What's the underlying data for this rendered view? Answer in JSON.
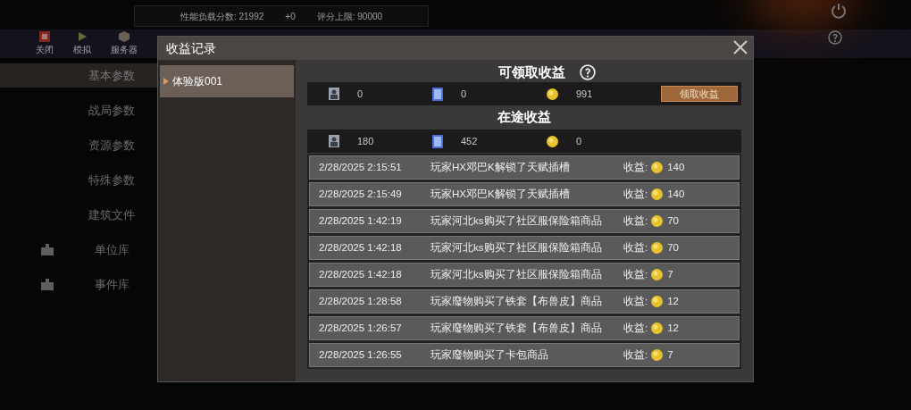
{
  "top_bar": {
    "score": "性能负载分数: 21992",
    "delta": "+0",
    "limit": "评分上限: 90000"
  },
  "toolbar": [
    {
      "label": "关闭",
      "kind": "stop"
    },
    {
      "label": "模拟",
      "kind": "play"
    },
    {
      "label": "服务器",
      "kind": "cube"
    }
  ],
  "sidebar": {
    "items": [
      {
        "label": "基本参数",
        "selected": true,
        "kind": "plain"
      },
      {
        "label": "战局参数",
        "selected": false,
        "kind": "plain"
      },
      {
        "label": "资源参数",
        "selected": false,
        "kind": "plain"
      },
      {
        "label": "特殊参数",
        "selected": false,
        "kind": "plain"
      },
      {
        "label": "建筑文件",
        "selected": false,
        "kind": "plain"
      },
      {
        "label": "单位库",
        "selected": false,
        "kind": "library"
      },
      {
        "label": "事件库",
        "selected": false,
        "kind": "library"
      }
    ]
  },
  "dialog": {
    "title": "收益记录",
    "versions": [
      {
        "label": "体验版001",
        "selected": true
      }
    ],
    "claimable": {
      "title": "可领取收益",
      "unit": "0",
      "card": "0",
      "coin": "991",
      "button": "领取收益"
    },
    "pending": {
      "title": "在途收益",
      "unit": "180",
      "card": "452",
      "coin": "0"
    },
    "records": [
      {
        "time": "2/28/2025 2:15:51",
        "event": "玩家HX邓巴K解锁了天赋插槽",
        "label": "收益:",
        "amount": "140"
      },
      {
        "time": "2/28/2025 2:15:49",
        "event": "玩家HX邓巴K解锁了天赋插槽",
        "label": "收益:",
        "amount": "140"
      },
      {
        "time": "2/28/2025 1:42:19",
        "event": "玩家河北ks购买了社区服保险箱商品",
        "label": "收益:",
        "amount": "70"
      },
      {
        "time": "2/28/2025 1:42:18",
        "event": "玩家河北ks购买了社区服保险箱商品",
        "label": "收益:",
        "amount": "70"
      },
      {
        "time": "2/28/2025 1:42:18",
        "event": "玩家河北ks购买了社区服保险箱商品",
        "label": "收益:",
        "amount": "7"
      },
      {
        "time": "2/28/2025 1:28:58",
        "event": "玩家廢物购买了铁套【布兽皮】商品",
        "label": "收益:",
        "amount": "12"
      },
      {
        "time": "2/28/2025 1:26:57",
        "event": "玩家廢物购买了铁套【布兽皮】商品",
        "label": "收益:",
        "amount": "12"
      },
      {
        "time": "2/28/2025 1:26:55",
        "event": "玩家廢物购买了卡包商品",
        "label": "收益:",
        "amount": "7"
      }
    ]
  }
}
